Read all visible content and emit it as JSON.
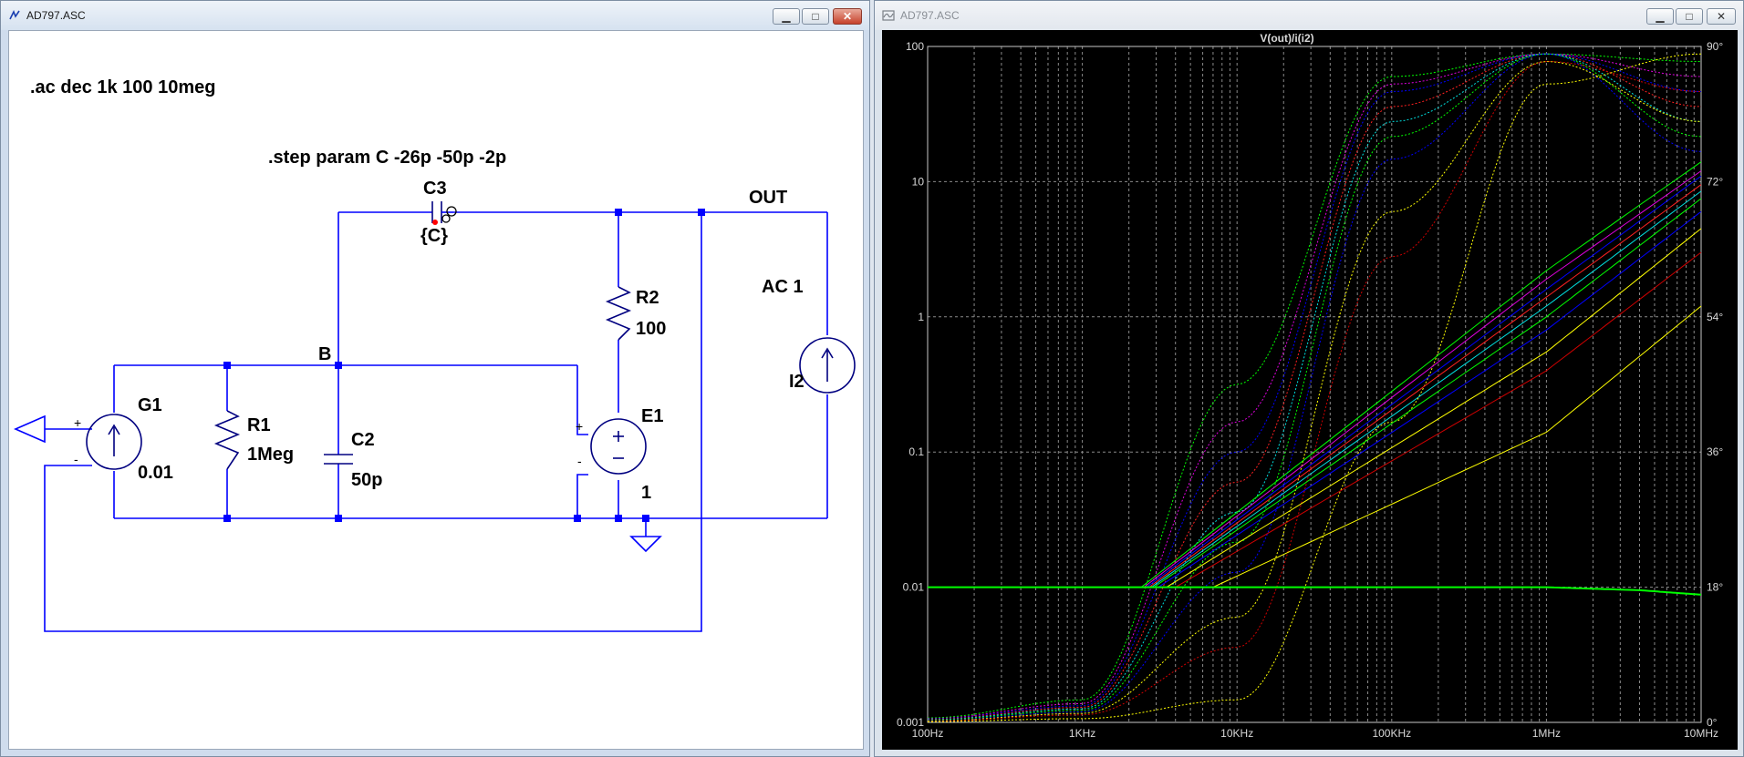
{
  "schematic_window": {
    "title": "AD797.ASC",
    "directives": {
      "ac": ".ac dec 1k 100 10meg",
      "step": ".step param C -26p -50p -2p"
    },
    "labels": {
      "c3_name": "C3",
      "c3_value": "{C}",
      "net_out": "OUT",
      "net_b": "B",
      "r2_name": "R2",
      "r2_value": "100",
      "source_ac": "AC 1",
      "i2_name": "I2",
      "g1_name": "G1",
      "g1_value": "0.01",
      "r1_name": "R1",
      "r1_value": "1Meg",
      "c2_name": "C2",
      "c2_value": "50p",
      "e1_name": "E1",
      "e1_value": "1",
      "plus": "+",
      "minus": "-"
    }
  },
  "plot_window": {
    "title": "AD797.ASC",
    "trace_label": "V(out)/i(i2)",
    "accent": "#00ff00"
  },
  "window_buttons": {
    "minimize": "▁",
    "maximize": "□",
    "close": "✕"
  },
  "chart_data": {
    "type": "line",
    "title": "V(out)/i(i2)",
    "x_scale": "log",
    "xlim": [
      100,
      10000000
    ],
    "x_ticks": [
      "100Hz",
      "1KHz",
      "10KHz",
      "100KHz",
      "1MHz",
      "10MHz"
    ],
    "y_scale": "log",
    "ylim": [
      0.001,
      100
    ],
    "y_ticks": [
      "100",
      "10",
      "1",
      "0.1",
      "0.01",
      "0.001"
    ],
    "y2_ticks": [
      "90°",
      "72°",
      "54°",
      "36°",
      "18°",
      "0°"
    ],
    "y2lim": [
      0,
      90
    ],
    "grid": true,
    "magnitude_series": [
      {
        "color": "#00ff00",
        "x": [
          100,
          2400,
          1000000,
          10000000
        ],
        "y": [
          0.01,
          0.01,
          2.2,
          14
        ]
      },
      {
        "color": "#e000e0",
        "x": [
          100,
          2500,
          1000000,
          10000000
        ],
        "y": [
          0.01,
          0.01,
          1.9,
          12
        ]
      },
      {
        "color": "#0000ff",
        "x": [
          100,
          2600,
          1000000,
          10000000
        ],
        "y": [
          0.01,
          0.01,
          1.6,
          11
        ]
      },
      {
        "color": "#ff2020",
        "x": [
          100,
          2700,
          1000000,
          10000000
        ],
        "y": [
          0.01,
          0.01,
          1.4,
          9.5
        ]
      },
      {
        "color": "#00e0e0",
        "x": [
          100,
          2800,
          1000000,
          10000000
        ],
        "y": [
          0.01,
          0.01,
          1.2,
          8.5
        ]
      },
      {
        "color": "#00ff00",
        "x": [
          100,
          2900,
          1000000,
          10000000
        ],
        "y": [
          0.01,
          0.01,
          1.0,
          7.5
        ]
      },
      {
        "color": "#0000ff",
        "x": [
          100,
          3100,
          1000000,
          10000000
        ],
        "y": [
          0.01,
          0.01,
          0.8,
          6.0
        ]
      },
      {
        "color": "#ffff00",
        "x": [
          100,
          3500,
          1000000,
          10000000
        ],
        "y": [
          0.01,
          0.01,
          0.55,
          4.5
        ]
      },
      {
        "color": "#d00000",
        "x": [
          100,
          4000,
          1000000,
          10000000
        ],
        "y": [
          0.01,
          0.01,
          0.4,
          3.0
        ]
      },
      {
        "color": "#ffff00",
        "x": [
          100,
          7000,
          1000000,
          10000000
        ],
        "y": [
          0.01,
          0.01,
          0.14,
          1.2
        ]
      }
    ],
    "phase_series": [
      {
        "color": "#00ff00",
        "x": [
          100,
          1000,
          10000,
          100000,
          1000000,
          10000000
        ],
        "y": [
          0.6,
          3,
          45,
          86,
          89,
          88
        ]
      },
      {
        "color": "#e000e0",
        "x": [
          100,
          1000,
          10000,
          100000,
          1000000,
          10000000
        ],
        "y": [
          0.5,
          2.5,
          40,
          85,
          89,
          86
        ]
      },
      {
        "color": "#0000ff",
        "x": [
          100,
          1000,
          10000,
          100000,
          1000000,
          10000000
        ],
        "y": [
          0.45,
          2.2,
          36,
          84,
          89,
          84
        ]
      },
      {
        "color": "#ff2020",
        "x": [
          100,
          1000,
          10000,
          100000,
          1000000,
          10000000
        ],
        "y": [
          0.4,
          2,
          32,
          82,
          89,
          82
        ]
      },
      {
        "color": "#00e0e0",
        "x": [
          100,
          1000,
          10000,
          100000,
          1000000,
          10000000
        ],
        "y": [
          0.35,
          1.8,
          28,
          80,
          89,
          80
        ]
      },
      {
        "color": "#00ff00",
        "x": [
          100,
          1000,
          10000,
          100000,
          1000000,
          10000000
        ],
        "y": [
          0.3,
          1.6,
          24,
          78,
          89,
          78
        ]
      },
      {
        "color": "#0000ff",
        "x": [
          100,
          1000,
          10000,
          100000,
          1000000,
          10000000
        ],
        "y": [
          0.25,
          1.4,
          20,
          75,
          89,
          76
        ]
      },
      {
        "color": "#ffff00",
        "x": [
          100,
          1000,
          10000,
          100000,
          1000000,
          10000000
        ],
        "y": [
          0.2,
          1.2,
          14,
          68,
          88,
          80
        ]
      },
      {
        "color": "#d00000",
        "x": [
          100,
          1000,
          10000,
          100000,
          1000000,
          10000000
        ],
        "y": [
          0.15,
          1.0,
          10,
          62,
          88,
          84
        ]
      },
      {
        "color": "#ffff00",
        "x": [
          100,
          1000,
          10000,
          100000,
          1000000,
          10000000
        ],
        "y": [
          0.1,
          0.5,
          3,
          40,
          85,
          89
        ]
      }
    ],
    "flat_series": {
      "color": "#00ff00",
      "x": [
        100,
        1000000,
        4000000,
        10000000
      ],
      "y": [
        0.01,
        0.01,
        0.0095,
        0.0088
      ]
    }
  }
}
